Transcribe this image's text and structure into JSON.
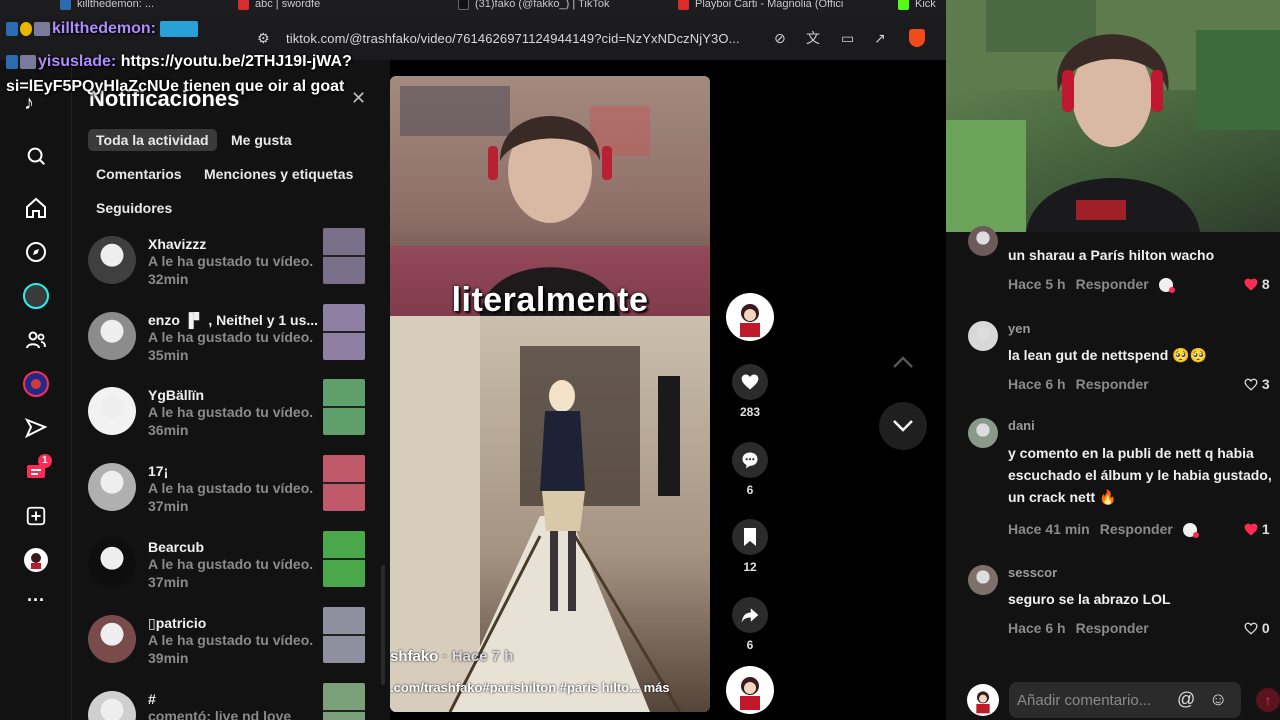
{
  "browser": {
    "tabs": [
      {
        "label": "killthedemon: ...",
        "color": "#2b6cb0"
      },
      {
        "label": "abc | swordfe",
        "color": "#d92d2d"
      },
      {
        "label": "(31)fako (@fakko_) | TikTok",
        "color": "#111111"
      },
      {
        "label": "Playboi Carti - Magnolia (Offici",
        "color": "#d92d2d"
      },
      {
        "label": "Kick",
        "color": "#53fc18"
      }
    ],
    "url": "tiktok.com/@trashfako/video/7614626971124944149?cid=NzYxNDczNjY3O..."
  },
  "chat": {
    "line1_user": "killthedemon:",
    "line2_user": "yisuslade:",
    "line2_text": "https://youtu.be/2THJ19I-jWA?",
    "line3_text": "si=lEyF5PQyHlaZcNUe tienen que oir al goat"
  },
  "rail": {
    "items": [
      "search-icon",
      "home-icon",
      "explore-icon",
      "live-icon",
      "following-icon",
      "rainbow-icon",
      "inbox-icon",
      "messages-icon",
      "upload-icon",
      "profile-icon",
      "more-icon"
    ],
    "messages_badge": "1"
  },
  "notifications": {
    "title": "Notificaciones",
    "filters": [
      "Toda la actividad",
      "Me gusta",
      "Comentarios",
      "Menciones y etiquetas",
      "Seguidores"
    ],
    "items": [
      {
        "name": "Xhavizzz",
        "desc": "A le ha gustado tu vídeo.",
        "time": "32min",
        "av": "#3f3f3f",
        "thumb": "#7a6f88"
      },
      {
        "name": "enzo ▐▘ , Neithel y 1 us...",
        "desc": "A le ha gustado tu vídeo.",
        "time": "35min",
        "av": "#8c8c8c",
        "thumb": "#8f7fa3"
      },
      {
        "name": "YgBällïn",
        "desc": "A le ha gustado tu vídeo.",
        "time": "36min",
        "av": "#f2f2f2",
        "thumb": "#5f9f6a"
      },
      {
        "name": "17¡",
        "desc": "A le ha gustado tu vídeo.",
        "time": "37min",
        "av": "#b0b0b0",
        "thumb": "#c05a6a"
      },
      {
        "name": "Bearcub",
        "desc": "A le ha gustado tu vídeo.",
        "time": "37min",
        "av": "#0e0e0e",
        "thumb": "#4aa84a"
      },
      {
        "name": "▯patricio",
        "desc": "A le ha gustado tu vídeo.",
        "time": "39min",
        "av": "#7a4b4b",
        "thumb": "#8f8f9f"
      },
      {
        "name": "#",
        "desc": "comentó: live nd love",
        "time": "",
        "av": "#cfcfcf",
        "thumb": "#7aa07a"
      }
    ]
  },
  "video": {
    "caption_word": "literalmente",
    "author": "shfako",
    "ago": "· Hace 7 h",
    "description": ".com/trashfako#parishilton #paris hilto...",
    "more": "más"
  },
  "actions": {
    "likes": "283",
    "comments": "6",
    "saves": "12",
    "shares": "6"
  },
  "comments": {
    "items": [
      {
        "user": "",
        "text": "un sharau a París hilton wacho",
        "ago": "Hace 5 h",
        "reply": "Responder",
        "likes": "8",
        "liked": true,
        "creator_liked": true,
        "av": "#6d5b5b"
      },
      {
        "user": "yen",
        "text": "la lean gut de nettspend 🥺🥺",
        "ago": "Hace 6 h",
        "reply": "Responder",
        "likes": "3",
        "liked": false,
        "creator_liked": false,
        "av": "#d8d8d8"
      },
      {
        "user": "dani",
        "text": "y comento en la publi de nett q habia escuchado el álbum y le habia gustado, un crack nett 🔥",
        "ago": "Hace 41 min",
        "reply": "Responder",
        "likes": "1",
        "liked": true,
        "creator_liked": true,
        "av": "#8a9a8a"
      },
      {
        "user": "sesscor",
        "text": "seguro se la abrazo LOL",
        "ago": "Hace 6 h",
        "reply": "Responder",
        "likes": "0",
        "liked": false,
        "creator_liked": false,
        "av": "#7f6f6a"
      }
    ],
    "input_placeholder": "Añadir comentario...",
    "accent": "#fe2c55"
  }
}
